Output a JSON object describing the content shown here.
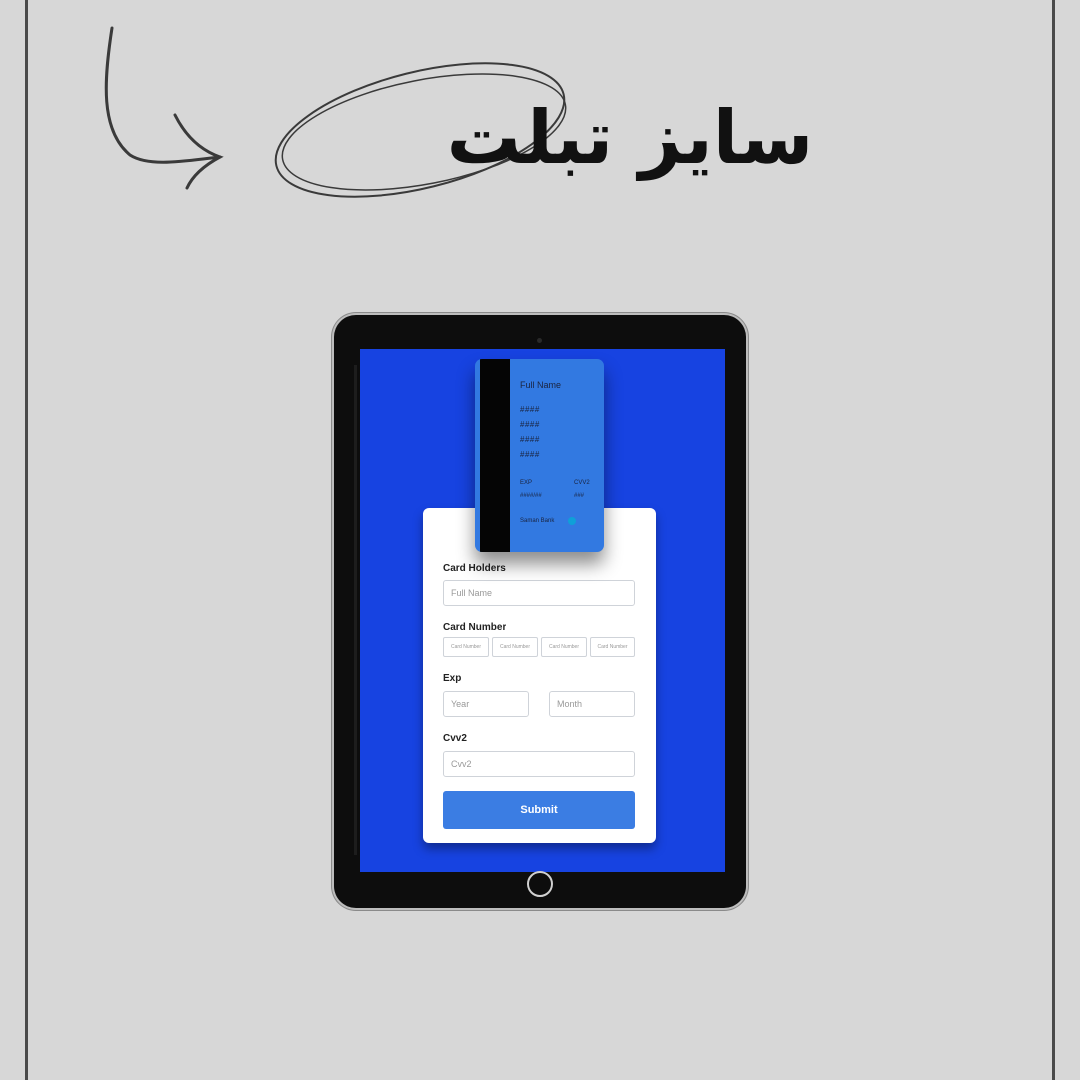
{
  "heading": {
    "text": "سایز تبلت"
  },
  "card": {
    "full_name": "Full Name",
    "number_groups": [
      "####",
      "####",
      "####",
      "####"
    ],
    "exp_label": "EXP",
    "exp_value": "####/##",
    "cvv_label": "CVV2",
    "cvv_value": "###",
    "bank": "Saman Bank"
  },
  "form": {
    "card_holders_label": "Card Holders",
    "full_name_placeholder": "Full Name",
    "card_number_label": "Card Number",
    "card_number_placeholders": [
      "Card Number",
      "Card Number",
      "Card Number",
      "Card Number"
    ],
    "exp_label": "Exp",
    "year_placeholder": "Year",
    "month_placeholder": "Month",
    "cvv_label": "Cvv2",
    "cvv_placeholder": "Cvv2",
    "submit_label": "Submit"
  },
  "colors": {
    "background": "#d7d7d7",
    "screen": "#1743e1",
    "card": "#3279e1",
    "submit": "#3b7de3"
  }
}
